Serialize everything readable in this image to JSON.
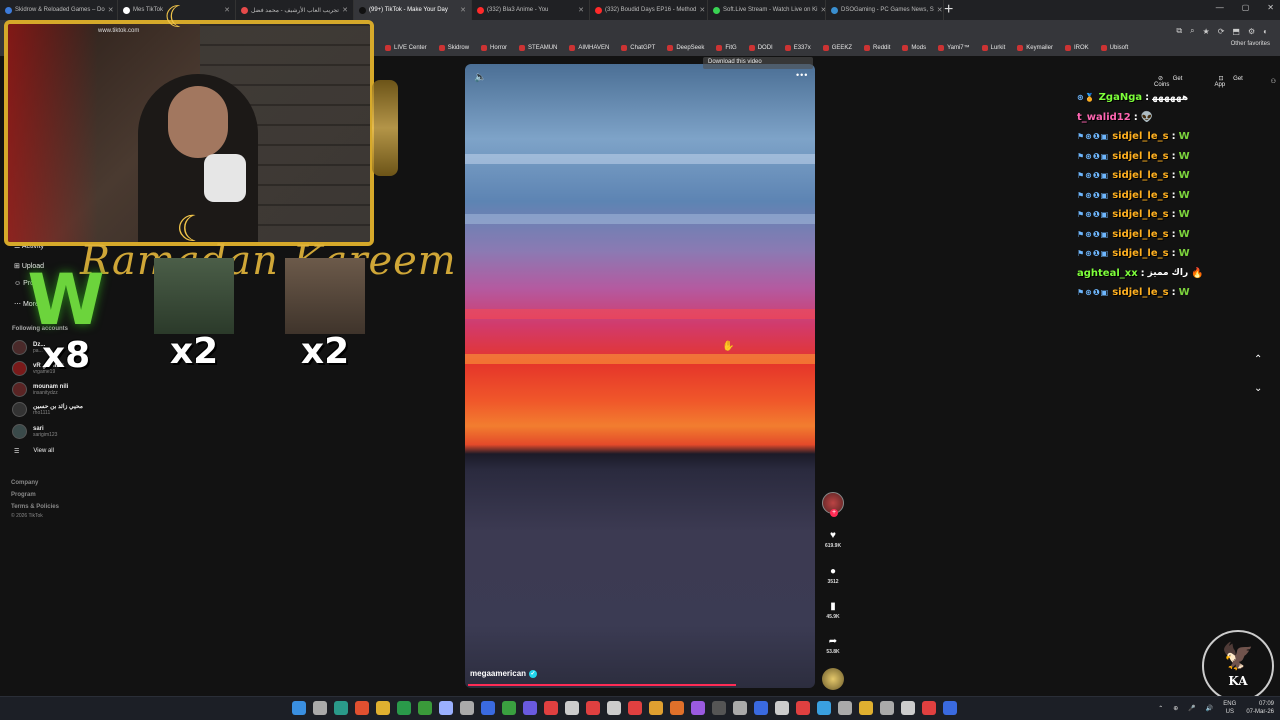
{
  "browser": {
    "tabs": [
      {
        "title": "Skidrow & Reloaded Games – Do",
        "color": "#3d7bd9"
      },
      {
        "title": "Mes TikTok",
        "color": "#ffffff"
      },
      {
        "title": "تجريب العاب الأرشيف - محمد فضل",
        "color": "#e64a4a"
      },
      {
        "title": "(99+) TikTok - Make Your Day",
        "color": "#111111",
        "active": true
      },
      {
        "title": "(332) Bla3 Anime - You",
        "color": "#ff2a2a"
      },
      {
        "title": "(332) Boudid Days EP16 - Method",
        "color": "#ff2a2a"
      },
      {
        "title": "Soft.Live Stream - Watch Live on Ki",
        "color": "#39d353"
      },
      {
        "title": "DSOGaming - PC Games News, S",
        "color": "#3a8fd0"
      }
    ],
    "new_tab": "+",
    "bookmarks": [
      "LIVE Center",
      "Skidrow",
      "Horror",
      "STEAMUN",
      "AIMHAVEN",
      "ChatGPT",
      "DeepSeek",
      "FitG",
      "DODI",
      "E337x",
      "GEEKZ",
      "Reddit",
      "Mods",
      "Yami7™",
      "Lurkit",
      "Keymailer",
      "IROK",
      "Ubisoft"
    ],
    "other_favorites": "Other favorites",
    "window_controls": [
      "—",
      "▢",
      "✕"
    ],
    "url_icons": [
      "⧉",
      "⌕",
      "★",
      "⟳",
      "⬒",
      "⚙",
      "◐"
    ]
  },
  "webcam": {
    "url_overlay": "www.tiktok.com",
    "banner": "Ramadan Kareem",
    "moon": "☾",
    "star": "★"
  },
  "sidebar": {
    "nav": [
      {
        "icon": "☰",
        "label": "Activity"
      },
      {
        "icon": "⊞",
        "label": "Upload"
      },
      {
        "icon": "☺",
        "label": "Profile"
      },
      {
        "icon": "⋯",
        "label": "More"
      }
    ],
    "following_title": "Following accounts",
    "accounts": [
      {
        "name": "Dz...",
        "handle": "pa...",
        "av": "#4a2a2a"
      },
      {
        "name": "vR gaming",
        "handle": "vrgame19",
        "av": "#7a1a1a"
      },
      {
        "name": "mounam nili",
        "handle": "insanitydzz",
        "av": "#5a2424"
      },
      {
        "name": "محيي زائد بن حسين",
        "handle": "rho1111",
        "av": "#333333"
      },
      {
        "name": "sari",
        "handle": "sarigim123",
        "av": "#3a4a4a"
      }
    ],
    "view_all_icon": "☰",
    "view_all": "View all",
    "footer": [
      "Company",
      "Program",
      "Terms & Policies"
    ],
    "copyright": "© 2026 TikTok"
  },
  "gifts": [
    {
      "glyph": "W",
      "count": "x8"
    },
    {
      "glyph": "",
      "count": "x2"
    },
    {
      "glyph": "",
      "count": "x2"
    }
  ],
  "video": {
    "download_text": "Download this video",
    "mute_icon": "🔈",
    "more_icon": "•••",
    "author": "megaamerican",
    "verified_icon": "✓",
    "progress": 0.78,
    "cursor_icon": "✋"
  },
  "actions": {
    "follow_plus": "+",
    "like_icon": "♥",
    "likes": "619.9K",
    "comment_icon": "●",
    "comments": "3512",
    "save_icon": "▮",
    "saves": "45.9K",
    "share_icon": "➦",
    "shares": "53.8K"
  },
  "topright": {
    "get_coins": "Get Coins",
    "get_app": "Get App",
    "coin_icon": "⊘",
    "app_icon": "⊡",
    "profile_icon": "⚇"
  },
  "chat": [
    {
      "badges": "⊛🏅",
      "user": "ZgaNga",
      "color": "#7dff3a",
      "text": "ﻫﻬﻬﻬﻬﻬ",
      "emo": ""
    },
    {
      "badges": "",
      "user": "t_walid12",
      "color": "#ff66b2",
      "text": "",
      "emo": "👽"
    },
    {
      "badges": "⚑⊛❶▣",
      "user": "sidjel_le_s",
      "color": "#ffb020",
      "text": "",
      "emo": "W"
    },
    {
      "badges": "⚑⊛❶▣",
      "user": "sidjel_le_s",
      "color": "#ffb020",
      "text": "",
      "emo": "W"
    },
    {
      "badges": "⚑⊛❶▣",
      "user": "sidjel_le_s",
      "color": "#ffb020",
      "text": "",
      "emo": "W"
    },
    {
      "badges": "⚑⊛❶▣",
      "user": "sidjel_le_s",
      "color": "#ffb020",
      "text": "",
      "emo": "W"
    },
    {
      "badges": "⚑⊛❶▣",
      "user": "sidjel_le_s",
      "color": "#ffb020",
      "text": "",
      "emo": "W"
    },
    {
      "badges": "⚑⊛❶▣",
      "user": "sidjel_le_s",
      "color": "#ffb020",
      "text": "",
      "emo": "W"
    },
    {
      "badges": "⚑⊛❶▣",
      "user": "sidjel_le_s",
      "color": "#ffb020",
      "text": "",
      "emo": "W"
    },
    {
      "badges": "",
      "user": "aghteal_xx",
      "color": "#7dff3a",
      "text": "راك مميز",
      "emo": "🔥"
    },
    {
      "badges": "⚑⊛❶▣",
      "user": "sidjel_le_s",
      "color": "#ffb020",
      "text": "",
      "emo": "W"
    }
  ],
  "chat_colon": ":",
  "video_nav": {
    "up": "⌃",
    "down": "⌄"
  },
  "logo": {
    "bird": "🦅",
    "text": "KA"
  },
  "taskbar": {
    "icons": [
      "#3a8fe0",
      "#aaaaaa",
      "#2a9a8a",
      "#e05030",
      "#e0b030",
      "#2a9a4a",
      "#3a9a3a",
      "#9ab0ff",
      "#aaaaaa",
      "#3a6ae0",
      "#3aa040",
      "#6a5ae0",
      "#e04040",
      "#ccc",
      "#e04040",
      "#ccc",
      "#e04040",
      "#e0a030",
      "#e0702a",
      "#9a5ae0",
      "#555",
      "#aaa",
      "#3a6ae0",
      "#ccc",
      "#e04040",
      "#3aa0e0",
      "#aaa",
      "#e0b030",
      "#aaa",
      "#ccc",
      "#e04040",
      "#3a6ae0"
    ],
    "lang_top": "ENG",
    "lang_bottom": "US",
    "time": "07:09",
    "date": "07-Mar-26",
    "tray_icons": [
      "⌃",
      "⊕",
      "🎤",
      "🔊"
    ]
  }
}
